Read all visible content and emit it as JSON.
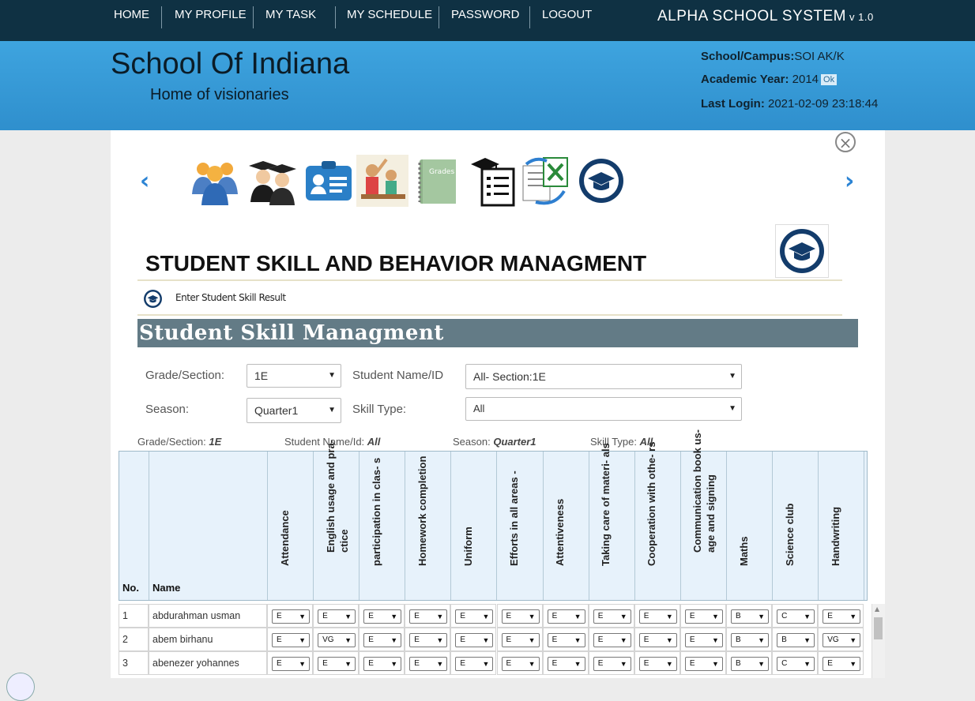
{
  "nav": {
    "items": [
      "HOME",
      "MY PROFILE",
      "MY TASK",
      "MY SCHEDULE",
      "PASSWORD",
      "LOGOUT"
    ],
    "brand": "ALPHA SCHOOL SYSTEM",
    "version": "v 1.0"
  },
  "banner": {
    "school_name": "School Of Indiana",
    "motto": "Home of visionaries",
    "campus_label": "School/Campus:",
    "campus_value": "SOI AK/K",
    "year_label": "Academic Year:",
    "year_value": "2014",
    "ok_label": "Ok",
    "login_label": "Last Login:",
    "login_value": "2021-02-09 23:18:44"
  },
  "toolbar": {
    "prev": "‹",
    "next": "›",
    "close": "×",
    "icons": [
      "users-icon",
      "graduates-icon",
      "id-card-icon",
      "classroom-icon",
      "grades-book-icon",
      "checklist-icon",
      "excel-sync-icon",
      "graduation-cap-icon"
    ]
  },
  "page": {
    "title": "STUDENT SKILL AND BEHAVIOR MANAGMENT",
    "sub_link": "Enter Student Skill Result",
    "section_title": "Student Skill Managment"
  },
  "form": {
    "grade_label": "Grade/Section:",
    "grade_value": "1E",
    "student_label": "Student Name/ID",
    "student_value": "All- Section:1E",
    "season_label": "Season:",
    "season_value": "Quarter1",
    "skill_label": "Skill Type:",
    "skill_value": "All"
  },
  "filters": {
    "grade_label": "Grade/Section:",
    "grade_value": "1E",
    "student_label": "Student Name/Id:",
    "student_value": "All",
    "season_label": "Season:",
    "season_value": "Quarter1",
    "skill_label": "Skill Type:",
    "skill_value": "All"
  },
  "table": {
    "no_header": "No.",
    "name_header": "Name",
    "skill_headers": [
      "Attendance",
      "English usage and pra- ctice",
      "participation in clas- s",
      "Homework completion",
      "Uniform",
      "Efforts in all areas -",
      "Attentiveness",
      "Taking care of materi- als",
      "Cooperation with othe- rs",
      "Communication book us- age and signing",
      "Maths",
      "Science club",
      "Handwriting"
    ],
    "rows": [
      {
        "no": "1",
        "name": "abdurahman usman",
        "grades": [
          "E",
          "E",
          "E",
          "E",
          "E",
          "E",
          "E",
          "E",
          "E",
          "E",
          "B",
          "C",
          "E"
        ]
      },
      {
        "no": "2",
        "name": "abem birhanu",
        "grades": [
          "E",
          "VG",
          "E",
          "E",
          "E",
          "E",
          "E",
          "E",
          "E",
          "E",
          "B",
          "B",
          "VG"
        ]
      },
      {
        "no": "3",
        "name": "abenezer yohannes",
        "grades": [
          "E",
          "E",
          "E",
          "E",
          "E",
          "E",
          "E",
          "E",
          "E",
          "E",
          "B",
          "C",
          "E"
        ]
      }
    ]
  }
}
